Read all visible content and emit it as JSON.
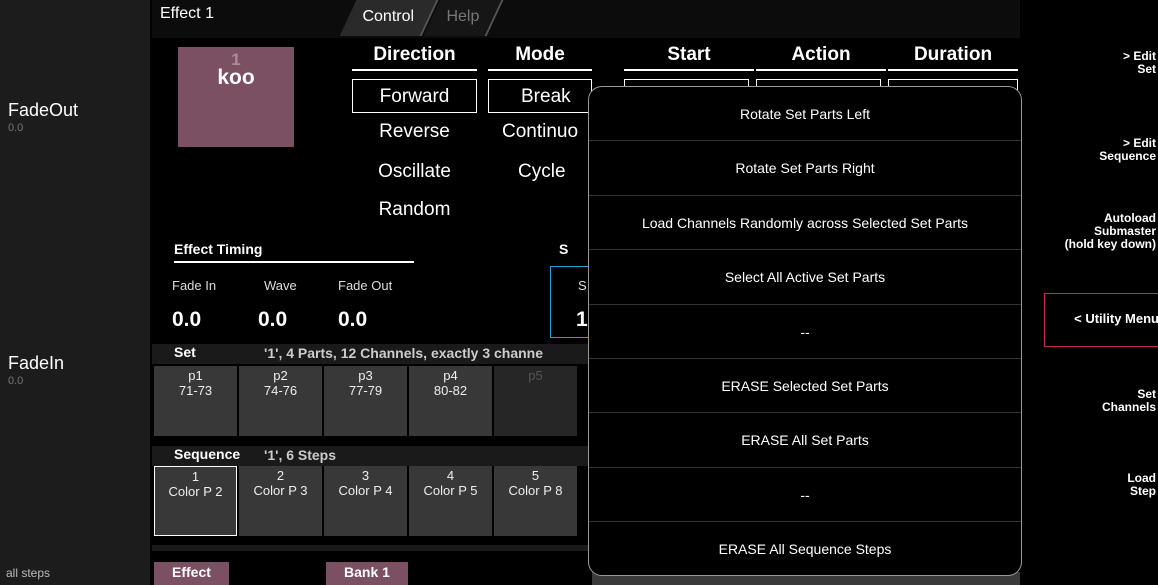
{
  "left": {
    "faders": [
      {
        "name": "FadeOut",
        "value": "0.0"
      },
      {
        "name": "FadeIn",
        "value": "0.0"
      }
    ],
    "bottom_label": "all steps"
  },
  "tabs": {
    "effect_title": "Effect 1",
    "control": "Control",
    "help": "Help"
  },
  "bank": {
    "number": "1",
    "label": "koo"
  },
  "columns": {
    "direction": {
      "header": "Direction",
      "options": [
        "Forward",
        "Reverse",
        "Oscillate",
        "Random"
      ],
      "selected": "Forward"
    },
    "mode": {
      "header": "Mode",
      "options": [
        "Break",
        "Continuo",
        "Cycle"
      ],
      "selected": "Break"
    },
    "start": {
      "header": "Start"
    },
    "action": {
      "header": "Action"
    },
    "duration": {
      "header": "Duration"
    }
  },
  "timing": {
    "title": "Effect Timing",
    "fields": [
      {
        "label": "Fade In",
        "value": "0.0"
      },
      {
        "label": "Wave",
        "value": "0.0"
      },
      {
        "label": "Fade Out",
        "value": "0.0"
      }
    ],
    "s_header": "S",
    "s_label": "S",
    "s_value": "1."
  },
  "set": {
    "label": "Set",
    "info": "'1', 4 Parts, 12 Channels, exactly 3 channe",
    "parts": [
      {
        "name": "p1",
        "range": "71-73"
      },
      {
        "name": "p2",
        "range": "74-76"
      },
      {
        "name": "p3",
        "range": "77-79"
      },
      {
        "name": "p4",
        "range": "80-82"
      },
      {
        "name": "p5",
        "range": ""
      }
    ]
  },
  "sequence": {
    "label": "Sequence",
    "info": "'1', 6 Steps",
    "steps": [
      {
        "num": "1",
        "name": "Color P 2"
      },
      {
        "num": "2",
        "name": "Color P 3"
      },
      {
        "num": "3",
        "name": "Color P 4"
      },
      {
        "num": "4",
        "name": "Color P 5"
      },
      {
        "num": "5",
        "name": "Color P 8"
      }
    ]
  },
  "bottom_tabs": {
    "effect": "Effect",
    "bank": "Bank 1"
  },
  "right_buttons": [
    {
      "line1": "> Edit",
      "line2": "Set",
      "line3": ""
    },
    {
      "line1": "> Edit",
      "line2": "Sequence",
      "line3": ""
    },
    {
      "line1": "Autoload",
      "line2": "Submaster",
      "line3": "(hold key down)"
    },
    {
      "line1": "< Utility Menu",
      "line2": "",
      "line3": ""
    },
    {
      "line1": "Set",
      "line2": "Channels",
      "line3": ""
    },
    {
      "line1": "Load",
      "line2": "Step",
      "line3": ""
    }
  ],
  "popup_menu": {
    "items": [
      "Rotate Set Parts Left",
      "Rotate Set Parts Right",
      "Load Channels Randomly across Selected Set Parts",
      "Select All Active Set Parts",
      "--",
      "ERASE Selected Set Parts",
      "ERASE All Set Parts",
      "--",
      "ERASE All Sequence Steps"
    ]
  },
  "colors": {
    "accent_mauve": "#7a5062",
    "highlight_blue": "#1aa3d4",
    "utility_red": "#c62a55"
  }
}
